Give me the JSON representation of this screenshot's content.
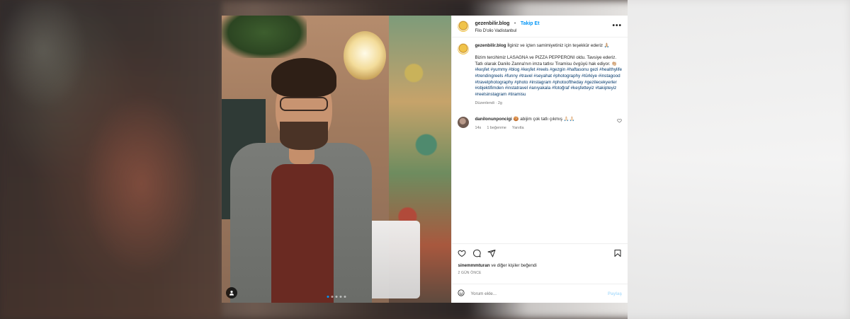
{
  "post": {
    "username": "gezenbilir.blog",
    "separator": "•",
    "follow_label": "Takip Et",
    "location": "Filo D'olio Vadistanbul",
    "more_label": "•••",
    "caption_username": "gezenbilir.blog",
    "caption_line1": "İlginiz ve içten samimiyetiniz için teşekkür ederiz 🙏🏼",
    "caption_text": "Bizim tercihimiz LASAGNA ve PIZZA PEPPERONI oldu. Tavsiye ederiz. Tatlı olarak Danilo Zanna'nın imza tatlısı Tiramisu övgüyü hak ediyor. 👏🏼",
    "hashtags": "#keşfet #yummy #blog #keşfet #reels #gezgin #haftasonu gezi #healthylife #trendingreels #funny #travel #seyahat #photography #türkiye #instagood #travelphotography #photo #instagram #photooftheday #gezilecekyerler #objektifimden #instatravel #anıyakala #fotoğraf #keşfetteyiz #takipteyiz #reelsinstagram #tiramisu",
    "caption_meta": "Düzenlendi · 2g",
    "comment": {
      "username": "danilonunponcigi",
      "text": "🍪 abijim çok tatlı çıkmış 🙏🏻🙏🏻",
      "time": "14s",
      "likes": "1 beğenme",
      "reply": "Yanıtla"
    },
    "likes_user": "sinemmmturan",
    "likes_suffix": " ve diğer kişiler beğendi",
    "date": "2 GÜN ÖNCE",
    "comment_placeholder": "Yorum ekle...",
    "post_label": "Paylaş"
  },
  "icons": {
    "heart": "heart-icon",
    "comment": "comment-icon",
    "share": "share-icon",
    "save": "bookmark-icon",
    "emoji": "emoji-icon",
    "user": "user-icon",
    "more": "more-icon"
  },
  "carousel": {
    "count": 5,
    "active": 1
  },
  "colors": {
    "accent": "#0095f6",
    "text": "#262626",
    "muted": "#737373",
    "hashtag": "#00376b"
  }
}
